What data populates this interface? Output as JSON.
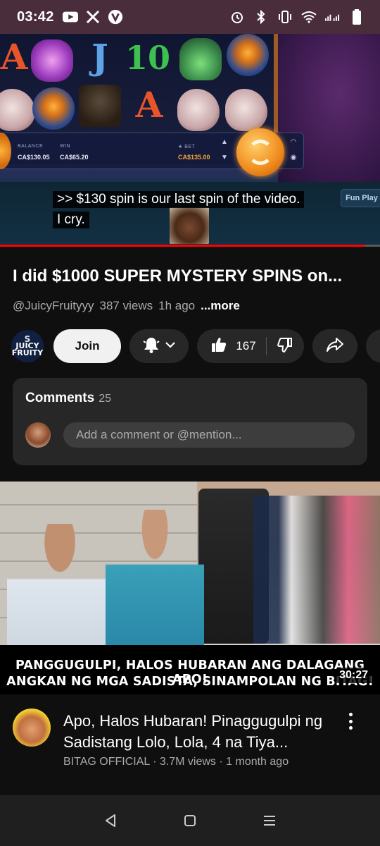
{
  "status_bar": {
    "time": "03:42",
    "left_icons": [
      "youtube-icon",
      "x-icon",
      "v-app-icon"
    ],
    "right_icons": [
      "alarm-icon",
      "bluetooth-icon",
      "vibrate-icon",
      "wifi-icon",
      "signal-icon",
      "battery-icon"
    ]
  },
  "player": {
    "caption_lines": [
      ">> $130 spin is our last spin of the video.",
      "I cry."
    ],
    "hud": {
      "balance_label": "BALANCE",
      "balance_value": "CA$130.05",
      "win_label": "WIN",
      "win_value": "CA$65.20",
      "bet_label": "★ BET",
      "bet_value": "CA$135.00"
    },
    "fun_play_label": "Fun Play",
    "progress": 0.96
  },
  "video": {
    "title": "I did $1000 SUPER MYSTERY SPINS on...",
    "channel": "@JuicyFruityyy",
    "views": "387 views",
    "age": "1h ago",
    "more_label": "...more",
    "channel_avatar": {
      "top": "S",
      "line1": "JUICY",
      "line2": "FRUITY"
    },
    "join_label": "Join",
    "likes": "167"
  },
  "comments": {
    "heading": "Comments",
    "count": "25",
    "placeholder": "Add a comment or @mention..."
  },
  "next_video": {
    "thumb_line1": "PANGGUGULPI, HALOS HUBARAN ANG DALAGANG APO!",
    "thumb_line2": "ANGKAN NG MGA SADISTA, SINAMPOLAN NG BITAG!",
    "duration": "30:27",
    "title": "Apo, Halos Hubaran! Pinaggugulpi ng Sadistang Lolo, Lola, 4 na Tiya...",
    "meta": "BITAG OFFICIAL · 3.7M views · 1 month ago"
  },
  "nav": [
    "back-icon",
    "home-icon",
    "recents-icon"
  ]
}
